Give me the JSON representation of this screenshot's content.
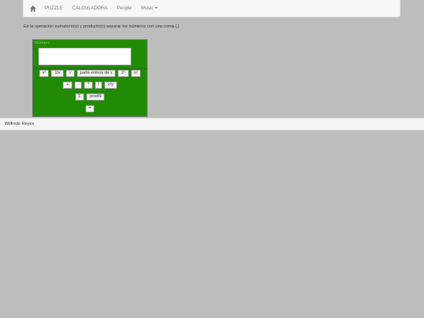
{
  "nav": {
    "home_icon": "home-icon",
    "items": [
      "PUZZLE",
      "CALCULADORA",
      "People"
    ],
    "dropdown_label": "Music"
  },
  "instructions": "En la operacion sumatorio(x) y producto(x) separar los números con una coma (,)",
  "calculator": {
    "display_label": "Número",
    "display_value": "",
    "row1": [
      "x²",
      "1/x",
      "√",
      "parte entera de x",
      "2ⁿ",
      "n!"
    ],
    "row2": [
      "+",
      "-",
      "*",
      "/",
      "xⁿy"
    ],
    "row3": [
      "Σ",
      "prodN"
    ],
    "row4": [
      "="
    ]
  },
  "footer": {
    "author": "Wilfredo Reyes"
  },
  "colors": {
    "calculator_bg": "#228b05",
    "page_bg": "#bdbdbd"
  }
}
